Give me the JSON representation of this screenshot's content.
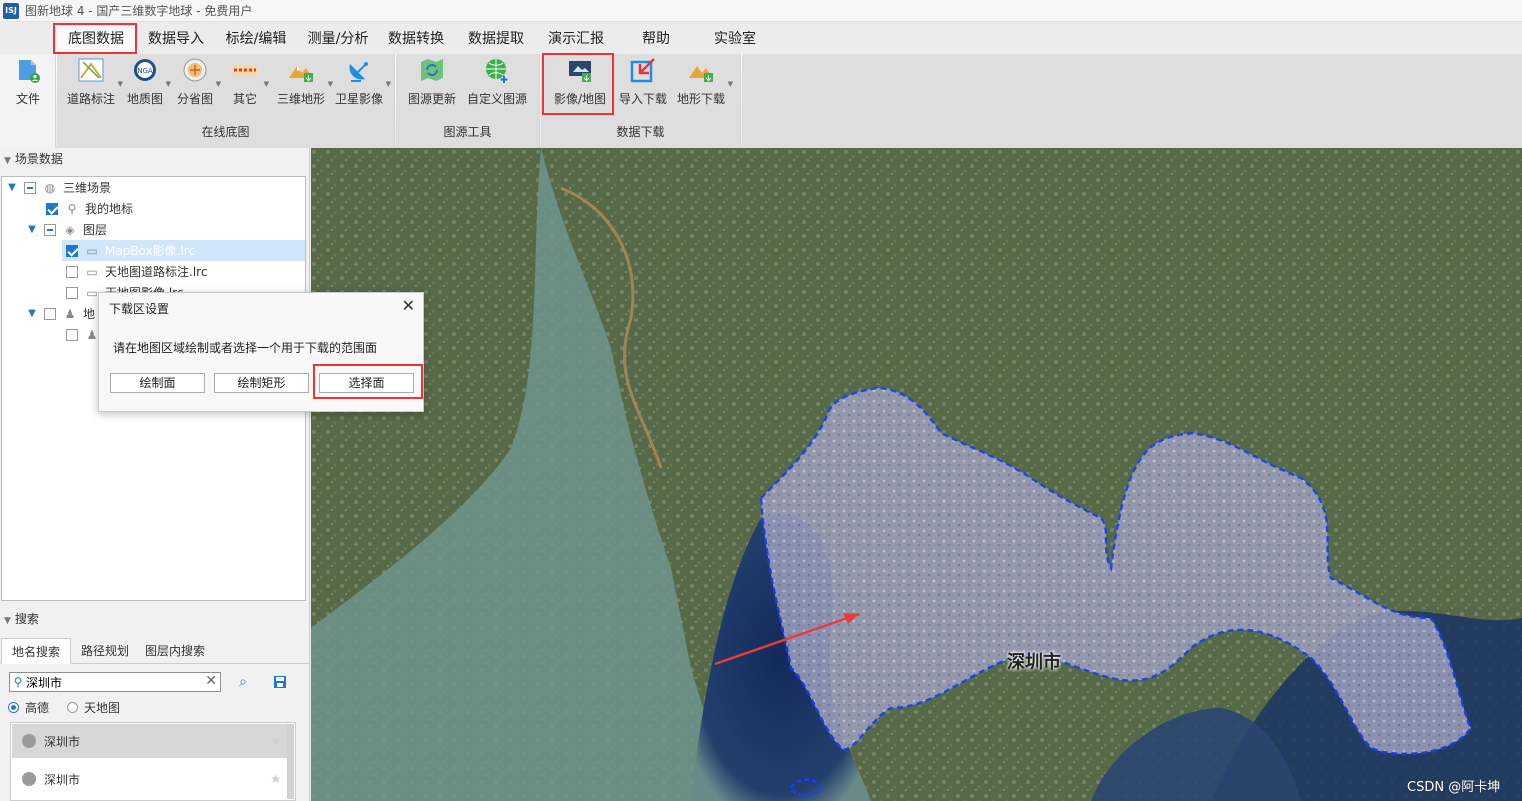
{
  "app": {
    "icon_text": "ISJ",
    "title": "图新地球 4 - 国产三维数字地球 - 免费用户"
  },
  "menu": {
    "tabs": [
      "底图数据",
      "数据导入",
      "标绘/编辑",
      "测量/分析",
      "数据转换",
      "数据提取",
      "演示汇报",
      "帮助",
      "实验室"
    ]
  },
  "ribbon": {
    "file_label": "文件",
    "groups": [
      {
        "label": "在线底图",
        "buttons": [
          "道路标注",
          "地质图",
          "分省图",
          "其它",
          "三维地形",
          "卫星影像"
        ]
      },
      {
        "label": "图源工具",
        "buttons": [
          "图源更新",
          "自定义图源"
        ]
      },
      {
        "label": "数据下载",
        "buttons": [
          "影像/地图",
          "导入下载",
          "地形下载"
        ]
      }
    ]
  },
  "scene_panel": {
    "header": "场景数据",
    "tree": [
      {
        "label": "三维场景"
      },
      {
        "label": "我的地标"
      },
      {
        "label": "图层"
      },
      {
        "label": "MapBox影像.lrc"
      },
      {
        "label": "天地图道路标注.lrc"
      },
      {
        "label": "天地图影像.lrc"
      },
      {
        "label": "地"
      },
      {
        "label": ""
      }
    ]
  },
  "search_panel": {
    "header": "搜索",
    "tabs": [
      "地名搜索",
      "路径规划",
      "图层内搜索"
    ],
    "input_value": "深圳市",
    "sources": [
      "高德",
      "天地图"
    ],
    "results": [
      "深圳市",
      "深圳市"
    ]
  },
  "dialog": {
    "title": "下载区设置",
    "close": "✕",
    "message": "请在地图区域绘制或者选择一个用于下载的范围面",
    "buttons": [
      "绘制面",
      "绘制矩形",
      "选择面"
    ]
  },
  "map": {
    "city_label": "深圳市",
    "watermark": "CSDN @阿卡坤",
    "highlight_color": "#1a3cff"
  }
}
